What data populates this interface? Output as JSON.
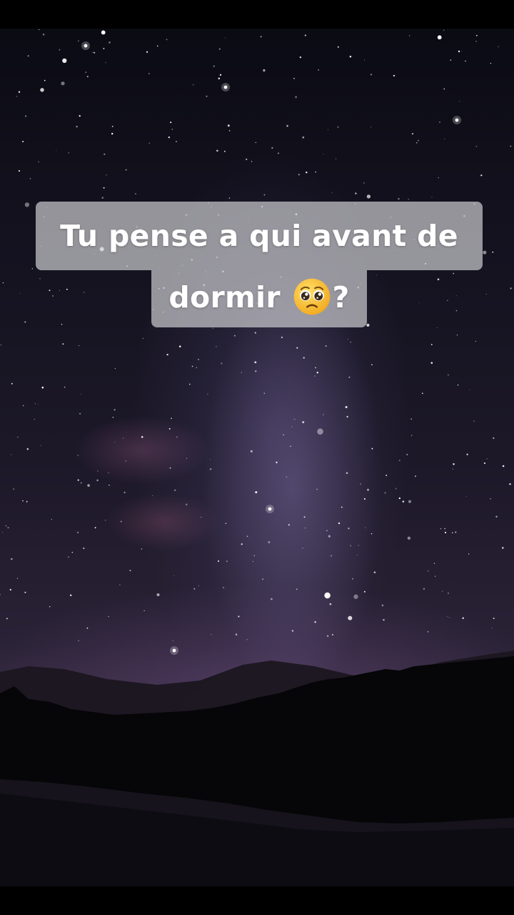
{
  "caption": {
    "line1": "Tu pense a qui avant de",
    "line2_text": "dormir ",
    "line2_suffix": "?",
    "emoji": "pleading-face-emoji"
  },
  "colors": {
    "caption_bg": "#c8c8cc",
    "caption_text": "#ffffff",
    "sky_top": "#0b0b14",
    "horizon_glow": "#3a2c45"
  }
}
